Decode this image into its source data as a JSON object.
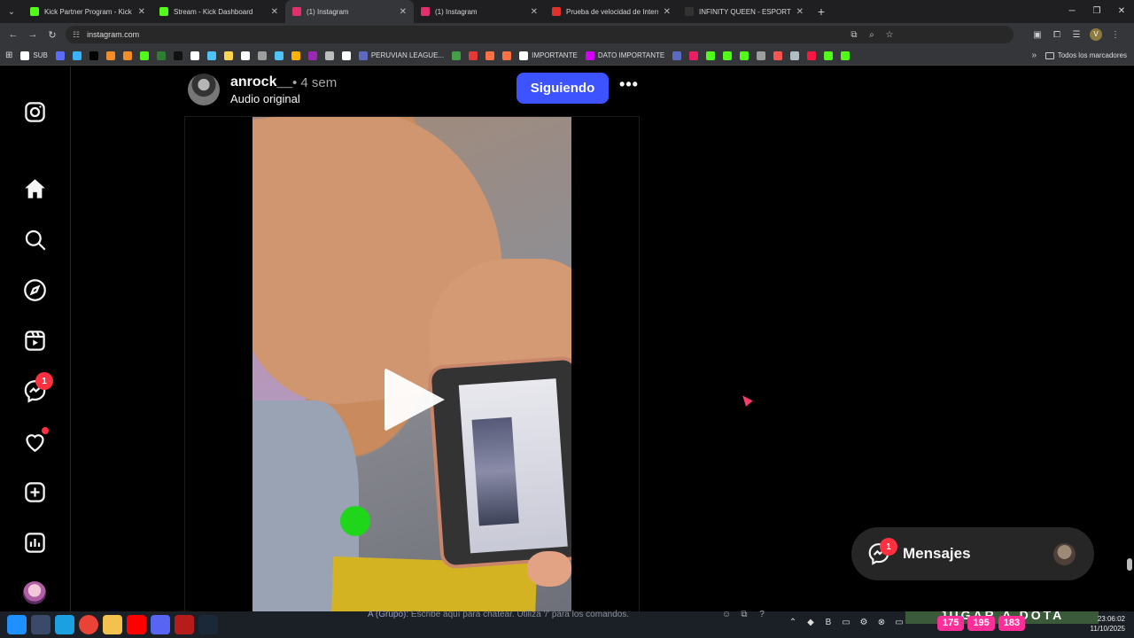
{
  "browser": {
    "tabs": [
      {
        "title": "Kick Partner Program - Kick Dash",
        "color": "#53fc18",
        "active": false
      },
      {
        "title": "Stream - Kick Dashboard",
        "color": "#53fc18",
        "active": false
      },
      {
        "title": "(1) Instagram",
        "color": "#e1306c",
        "active": true
      },
      {
        "title": "(1) Instagram",
        "color": "#e1306c",
        "active": false
      },
      {
        "title": "Prueba de velocidad de Interne",
        "color": "#e0312f",
        "active": false
      },
      {
        "title": "INFINITY QUEEN - ESPORTS FE",
        "color": "#222",
        "active": false
      }
    ],
    "url": "instagram.com",
    "bookmarks": [
      {
        "label": "SUB",
        "color": "#ffffff"
      },
      {
        "label": "",
        "color": "#5b6cff"
      },
      {
        "label": "",
        "color": "#3bb2ff"
      },
      {
        "label": "",
        "color": "#000000"
      },
      {
        "label": "",
        "color": "#f58c2a"
      },
      {
        "label": "",
        "color": "#f58c2a"
      },
      {
        "label": "",
        "color": "#53fc18"
      },
      {
        "label": "",
        "color": "#2e7d32"
      },
      {
        "label": "",
        "color": "#111111"
      },
      {
        "label": "",
        "color": "#ffffff"
      },
      {
        "label": "",
        "color": "#4fc3f7"
      },
      {
        "label": "",
        "color": "#ffd54f"
      },
      {
        "label": "",
        "color": "#ffffff"
      },
      {
        "label": "",
        "color": "#9e9e9e"
      },
      {
        "label": "",
        "color": "#4fc3f7"
      },
      {
        "label": "",
        "color": "#ffb300"
      },
      {
        "label": "",
        "color": "#9c27b0"
      },
      {
        "label": "",
        "color": "#bdbdbd"
      },
      {
        "label": "",
        "color": "#ffffff"
      },
      {
        "label": "PERUVIAN LEAGUE...",
        "color": "#5c6bc0"
      },
      {
        "label": "",
        "color": "#43a047"
      },
      {
        "label": "",
        "color": "#e53935"
      },
      {
        "label": "",
        "color": "#ff7043"
      },
      {
        "label": "",
        "color": "#ff7043"
      },
      {
        "label": "IMPORTANTE",
        "color": "#ffffff"
      },
      {
        "label": "DATO IMPORTANTE",
        "color": "#d500f9"
      },
      {
        "label": "",
        "color": "#5c6bc0"
      },
      {
        "label": "",
        "color": "#e91e63"
      },
      {
        "label": "",
        "color": "#53fc18"
      },
      {
        "label": "",
        "color": "#53fc18"
      },
      {
        "label": "",
        "color": "#53fc18"
      },
      {
        "label": "",
        "color": "#9e9e9e"
      },
      {
        "label": "",
        "color": "#ff5252"
      },
      {
        "label": "",
        "color": "#b0bec5"
      },
      {
        "label": "",
        "color": "#ff1744"
      },
      {
        "label": "",
        "color": "#53fc18"
      },
      {
        "label": "",
        "color": "#53fc18"
      }
    ],
    "all_bookmarks": "Todos los marcadores",
    "profile_initial": "V"
  },
  "sidebar": {
    "icons": [
      "instagram-logo-icon",
      "home-icon",
      "search-icon",
      "explore-icon",
      "reels-icon",
      "messenger-icon",
      "heart-icon",
      "create-icon",
      "dashboard-icon",
      "profile-avatar"
    ],
    "messages_badge": "1"
  },
  "post": {
    "username": "anrock__",
    "time": "• 4 sem",
    "audio": "Audio original",
    "follow_button": "Siguiendo",
    "more": "•••"
  },
  "messages_pill": {
    "label": "Mensajes",
    "badge": "1"
  },
  "stream_overlay": {
    "chat_prefix": "A (Grupo):",
    "chat_placeholder": "Escribe aquí para chatear. Utiliza '/' para los comandos.",
    "banner": "JUGAR A DOTA",
    "stats": [
      "175",
      "195",
      "183"
    ]
  },
  "taskbar": {
    "time": "23:06:02",
    "date": "11/10/2025"
  }
}
